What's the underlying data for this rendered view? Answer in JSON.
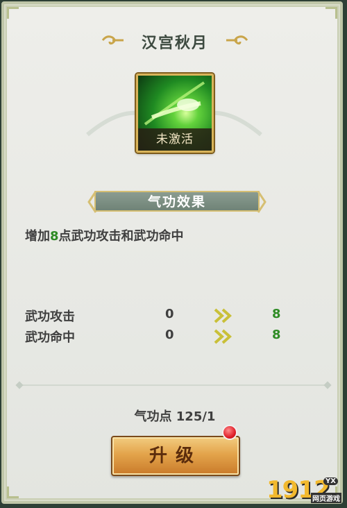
{
  "title": "汉宫秋月",
  "skill": {
    "status_label": "未激活",
    "icon": "green-slash-skill-icon"
  },
  "section": {
    "label": "气功效果"
  },
  "description": {
    "prefix": "增加",
    "value": "8",
    "suffix": "点武功攻击和武功命中"
  },
  "stats": [
    {
      "name": "武功攻击",
      "before": "0",
      "after": "8"
    },
    {
      "name": "武功命中",
      "before": "0",
      "after": "8"
    }
  ],
  "points": {
    "text": "气功点 125/1"
  },
  "upgrade": {
    "label": "升级"
  },
  "watermark": {
    "brand": "1912",
    "badge": "YX",
    "sub": "网页游戏"
  },
  "colors": {
    "accent_green": "#2e8b24",
    "button_orange": "#e3a44b",
    "notify_red": "#e0202a"
  }
}
